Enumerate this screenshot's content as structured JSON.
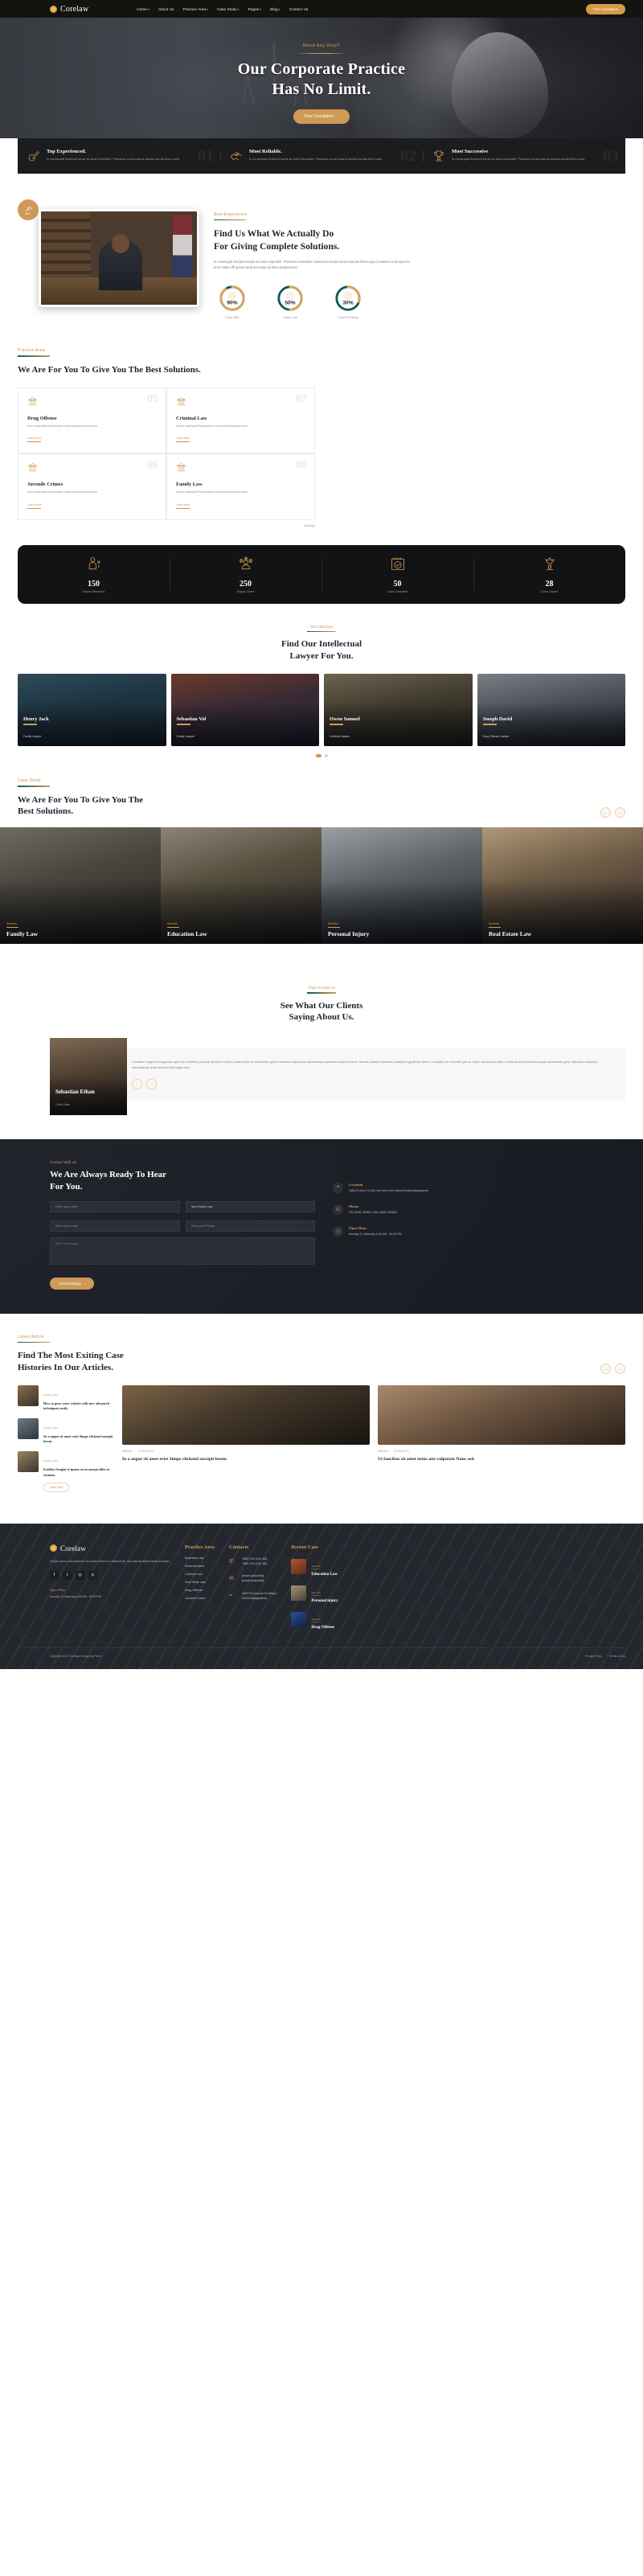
{
  "nav": {
    "brand": "Corelaw",
    "links": [
      {
        "label": "Home",
        "caret": true
      },
      {
        "label": "About Us",
        "caret": false
      },
      {
        "label": "Practice Area",
        "caret": true
      },
      {
        "label": "Case Study",
        "caret": true
      },
      {
        "label": "Pages",
        "caret": true
      },
      {
        "label": "Blog",
        "caret": true
      },
      {
        "label": "Contact Us",
        "caret": false
      }
    ],
    "cta": "Free Cosultation"
  },
  "hero": {
    "eyebrow": "Need Any Help?",
    "title_line1": "Our Corporate Practice",
    "title_line2": "Has No Limit.",
    "button": "Free Cosultation  →"
  },
  "features": [
    {
      "num": "01",
      "title": "Top Experienced.",
      "text": "In consequat tincidunt turpis sit amet imperdiet. Praesent nonat mauris laoreet.iaculis libero quis."
    },
    {
      "num": "02",
      "title": "Most Reliable.",
      "text": "In consequat tincidunt turpis sit amet imperdiet. Praesent nonat mauris laoreet.iaculis libero quis."
    },
    {
      "num": "03",
      "title": "Most Successive",
      "text": "In consequat tincidunt turpis sit amet imperdiet. Praesent nonat mauris laoreet.iaculis libero quis."
    }
  ],
  "about": {
    "kicker": "Best Experience",
    "title_line1": "Find Us What We Actually Do",
    "title_line2": "For Giving Complete Solutions.",
    "text": "In consequat tincidunt turpis sit amet imperdiet. Praesent ouiertdion nonatoura mauris laoreet.iaculis libero quis.Curabitur et tempusoni eros Class offi aptent taciti sociosqu ad litora torquent per.",
    "rings": [
      {
        "value": "90%",
        "label": "Case Win",
        "pct": 90,
        "color": "#d9a45c",
        "track": "#0f5a58"
      },
      {
        "value": "50%",
        "label": "Case Lost",
        "pct": 50,
        "color": "#d9a45c",
        "track": "#0f5a58"
      },
      {
        "value": "30%",
        "label": "Case Pending",
        "pct": 30,
        "color": "#d9a45c",
        "track": "#0f5a58"
      }
    ]
  },
  "practice": {
    "kicker": "Practice Area",
    "title_line1": "We Are For You To Give You The Best",
    "title_line2": "Solutions.",
    "more": "Manage",
    "cards": [
      {
        "num": "05",
        "title": "Drug Offense",
        "text": "amet imperdiet Praesentulni nonat mauris laoreet.iacui.",
        "link": "Learn More"
      },
      {
        "num": "07",
        "title": "Criminal Law",
        "text": "Lamet imperdiet Praesentulni nonat mauris laoreet.iacui.",
        "link": "Learn More"
      },
      {
        "num": "06",
        "title": "Juvenile Crimes",
        "text": "amet imperdiet Praesentulni nonat mauris laoreet.iacui.",
        "link": "Learn More"
      },
      {
        "num": "08",
        "title": "Family Law",
        "text": "Lamet imperdiet Praesentulni nonat mauris laoreet.iacui.",
        "link": "Learn More"
      }
    ]
  },
  "stats": [
    {
      "icon": "judge-icon",
      "num": "150",
      "label": "Expert Attorneys"
    },
    {
      "icon": "client-star-icon",
      "num": "250",
      "label": "Happy Client"
    },
    {
      "icon": "calendar-check-icon",
      "num": "50",
      "label": "Case Complete"
    },
    {
      "icon": "trophy-icon",
      "num": "28",
      "label": "Case Closed"
    }
  ],
  "team": {
    "kicker": "Our Attorneys",
    "title_line1": "Find Our Intellectual",
    "title_line2": "Lawyer For You.",
    "members": [
      {
        "name": "Henry Jack",
        "role": "Family Lawyer"
      },
      {
        "name": "Sebastian Vol",
        "role": "Family Lawyer"
      },
      {
        "name": "Owen Samuel",
        "role": "Criminal Lawyer"
      },
      {
        "name": "Joseph David",
        "role": "Drug Offense Lawyer"
      }
    ]
  },
  "case_study": {
    "kicker": "Case Study",
    "title_line1": "We Are For You To Give You The",
    "title_line2": "Best Solutions.",
    "prev": "←",
    "next": "→",
    "items": [
      {
        "small": "Skirmish",
        "title": "Family Law"
      },
      {
        "small": "Skirmish",
        "title": "Education Law"
      },
      {
        "small": "Skirmish",
        "title": "Personal Injury"
      },
      {
        "small": "Skirmish",
        "title": "Real Estate Law"
      }
    ]
  },
  "testimonial": {
    "kicker": "They Trusted Us",
    "title_line1": "See What Our Clients",
    "title_line2": "Saying About Us.",
    "name": "Sebastian Ethan",
    "role": "Crime Case",
    "quote": "Curabitur magna recognetas quis est in finibus pulvinar ipsume et Nunc vitae amet do sollicitudo gone interdum.maecenas doloritaetom quisullamcorper lectus. Mauris vitaelai faucibus amdipiom gestinue lidero. Curabitur eu convallis purus. Nunc accumsan diam in thelost.arcuki pellomosqua voldersalat gone interdum.maximus doloritaetom quis.Incifuriri thremigiy odio.",
    "prev": "←",
    "next": "→"
  },
  "contact": {
    "kicker": "Contact With Us",
    "title_line1": "We Are Always Ready To Hear",
    "title_line2": "For You.",
    "fields": {
      "name_placeholder": "Enter your name",
      "subject_placeholder": "Need More Law",
      "email_placeholder": "Enter your email",
      "phone_placeholder": "Enter your Phone",
      "message_placeholder": "Write a message"
    },
    "submit": "Send Message  →",
    "blocks": [
      {
        "icon": "location-icon",
        "title": "Location",
        "text": "168/170,Ave 01,Old York Drive Mcil\nMirpur,Dhaka,Bangladesh"
      },
      {
        "icon": "phone-icon",
        "title": "Phone",
        "text": "002-3646 789563\n+002-8486 789563"
      },
      {
        "icon": "clock-icon",
        "title": "Open Hour",
        "text": "Monday To Saturday\n9:00 AM - 05:30 PM"
      }
    ]
  },
  "blog": {
    "kicker": "Latest Article",
    "title_line1": "Find The Most Exiting Case",
    "title_line2": "Histories In Our Articles.",
    "prev": "←",
    "next": "→",
    "mini": [
      {
        "date": "25 May 2023",
        "title": "How to grow your website with new advanced techniques easily."
      },
      {
        "date": "25 May 2023",
        "title": "Its a augur sit amet erist Simpe clickend suscipit lorem."
      },
      {
        "date": "25 May 2023",
        "title": "Fasilisys feugiat et ipsum sit accumsan bibe at eronnas."
      }
    ],
    "more_btn": "Learn More",
    "cards": [
      {
        "cat": "Skirmish",
        "date": "25 May 2023",
        "title": "In a augur sit amet erist Simpe clickend suscipit lorem."
      },
      {
        "cat": "Skirmish",
        "date": "25 May 2023",
        "title": "Ut faucibus sit amet netus uist vulputate Nunc sed."
      }
    ]
  },
  "footer": {
    "brand": "Corelaw",
    "about": "Integer purus odio.placerat nec andi rhoncus in.ullamcorper nec dolorali aptent taciti sociosqu.",
    "socials": [
      "facebook-icon",
      "twitter-icon",
      "instagram-icon",
      "pinterest-icon"
    ],
    "open_hour_title": "Open Hour",
    "open_hour_text": "Monday To Saturday,9:00 AM - 05:30 PM",
    "practice_title": "Practice Area",
    "practice_items": [
      "Business Law",
      "Work Accident",
      "Criminal Law",
      "Real State Law",
      "Drug Offense",
      "Juvenile Crime"
    ],
    "contacts_title": "Contacts",
    "contacts": [
      {
        "icon": "phone-icon",
        "lines": [
          "+880 176 1111 456",
          "+880 176 1111 456"
        ]
      },
      {
        "icon": "mail-icon",
        "lines": [
          "[email protected]",
          "[email protected]"
        ]
      },
      {
        "icon": "location-icon",
        "lines": [
          "168/170,Avenue 01,Mirpur",
          "DOHS,Bangladesh"
        ]
      }
    ],
    "recent_title": "Recent Case",
    "recent": [
      {
        "small": "skirmish",
        "title": "Education Law"
      },
      {
        "small": "skirmish",
        "title": "Personal injury"
      },
      {
        "small": "skirmish",
        "title": "Drug Offense"
      }
    ],
    "copyright": "Copyright 2023 Corelaw | Design By Pixcel",
    "bar_links": [
      "Privacy Policy",
      "Terms of Use"
    ]
  }
}
